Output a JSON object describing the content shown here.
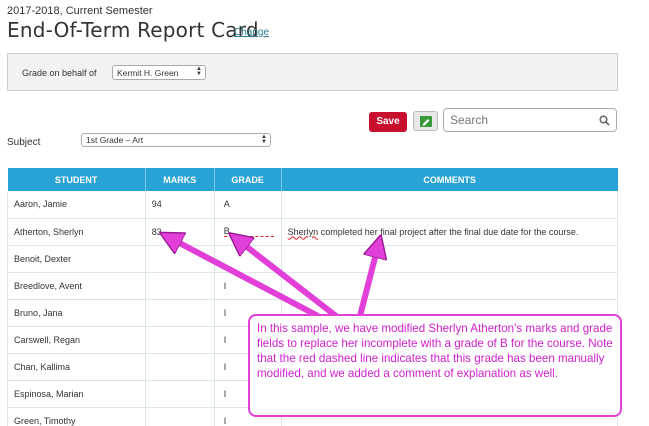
{
  "header": {
    "term": "2017-2018, Current Semester",
    "title": "End-Of-Term Report Card",
    "change_label": "Change"
  },
  "behalf": {
    "label": "Grade on behalf of",
    "selected": "Kermit H. Green"
  },
  "toolbar": {
    "save_label": "Save",
    "edit_icon": "pencil-icon",
    "search_placeholder": "Search",
    "search_icon": "search-icon"
  },
  "subject": {
    "label": "Subject",
    "selected": "1st Grade – Art"
  },
  "table": {
    "headers": [
      "STUDENT",
      "MARKS",
      "GRADE",
      "COMMENTS"
    ],
    "rows": [
      {
        "student": "Aaron, Jamie",
        "marks": "94",
        "grade": "A",
        "comment": ""
      },
      {
        "student": "Atherton, Sherlyn",
        "marks": "83",
        "grade": "B",
        "comment_first": "Sherlyn",
        "comment_rest": " completed her final project after the final due date for the course."
      },
      {
        "student": "Benoit, Dexter",
        "marks": "",
        "grade": "",
        "comment": ""
      },
      {
        "student": "Breedlove, Avent",
        "marks": "",
        "grade": "I",
        "comment": ""
      },
      {
        "student": "Bruno, Jana",
        "marks": "",
        "grade": "I",
        "comment": ""
      },
      {
        "student": "Carswell, Regan",
        "marks": "",
        "grade": "I",
        "comment": ""
      },
      {
        "student": "Chan, Kallima",
        "marks": "",
        "grade": "I",
        "comment": ""
      },
      {
        "student": "Espinosa, Marian",
        "marks": "",
        "grade": "I",
        "comment": ""
      },
      {
        "student": "Green, Timothy",
        "marks": "",
        "grade": "I",
        "comment": ""
      }
    ]
  },
  "annotation": {
    "text": "In this sample, we have modified Sherlyn Atherton's marks and grade fields to replace her incomplete with  a grade of B for the course. Note that the red dashed line indicates that this grade has been manually modified, and we added a comment of explanation as well.",
    "color": "#e23fd8"
  },
  "colors": {
    "header_blue": "#29a3d6",
    "save_red": "#c8102e",
    "link": "#2a7c8c"
  }
}
